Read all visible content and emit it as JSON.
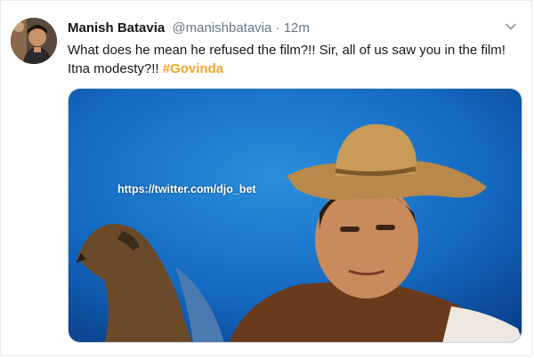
{
  "tweet": {
    "display_name": "Manish Batavia",
    "handle": "@manishbatavia",
    "separator": "·",
    "time": "12m",
    "text": "What does he mean he refused the film?!! Sir, all of us saw you in the film! Itna modesty?!! ",
    "hashtag": "#Govinda",
    "media": {
      "watermark": "https://twitter.com/djo_bet"
    }
  },
  "icons": {
    "caret": "chevron-down-icon",
    "avatar": "avatar"
  },
  "colors": {
    "hashtag": "#f5a623",
    "secondary_text": "#657786",
    "border": "#e6ecf0"
  }
}
